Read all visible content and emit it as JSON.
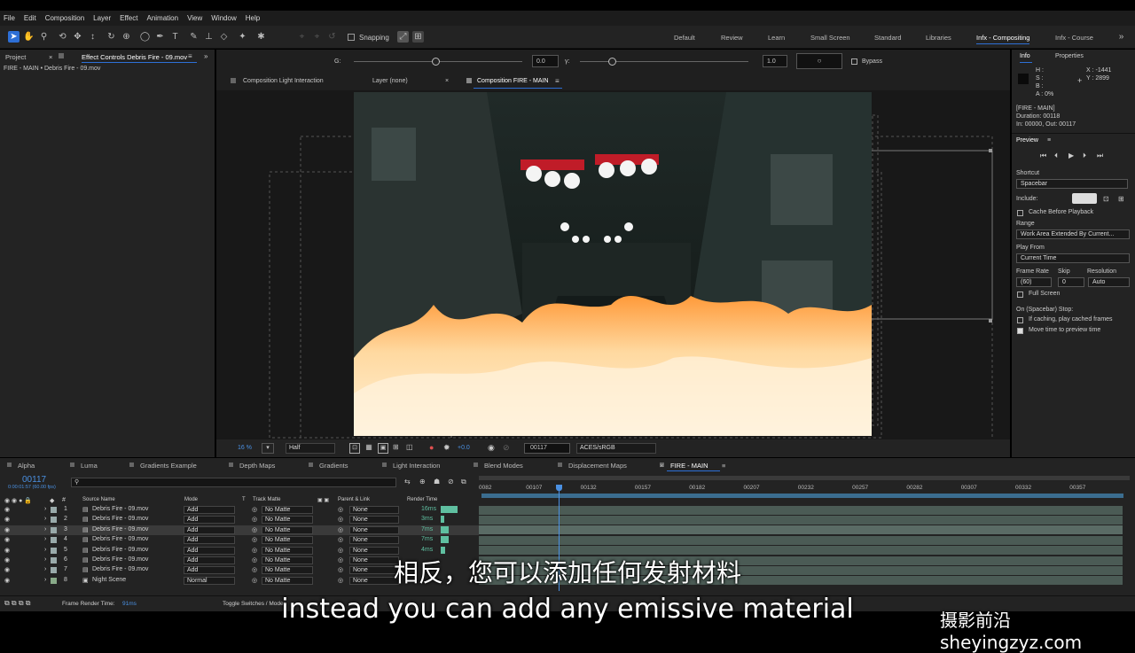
{
  "menu": [
    "File",
    "Edit",
    "Composition",
    "Layer",
    "Effect",
    "Animation",
    "View",
    "Window",
    "Help"
  ],
  "toolbar": {
    "snapping": "Snapping",
    "workspaces": [
      "Default",
      "Review",
      "Learn",
      "Small Screen",
      "Standard",
      "Libraries",
      "Infx - Compositing",
      "Infx - Course"
    ],
    "active_workspace": "Infx - Compositing"
  },
  "left_panel": {
    "tab_project": "Project",
    "tab_effect_controls": "Effect Controls Debris Fire - 09.mov",
    "path": "FIRE - MAIN • Debris Fire - 09.mov"
  },
  "comp": {
    "g_value": "0.0",
    "y_value": "1.0",
    "g_label": "G:",
    "y_label": "γ:",
    "o_label": "○",
    "bypass": "Bypass",
    "tabs": [
      "Composition Light Interaction",
      "Layer (none)",
      "Composition FIRE - MAIN"
    ],
    "zoom": "16 %",
    "resolution": "Half",
    "exposure": "+0.0",
    "timecode": "00117",
    "color_space": "ACES/sRGB"
  },
  "info": {
    "tab_info": "Info",
    "tab_properties": "Properties",
    "h": "H :",
    "s": "S :",
    "b": "B :",
    "a": "A : 0%",
    "x": "X : -1441",
    "y": "Y : 2899",
    "comp_name": "[FIRE - MAIN]",
    "duration": "Duration: 00118",
    "in_out": "In: 00000, Out: 00117"
  },
  "preview": {
    "title": "Preview",
    "shortcut_label": "Shortcut",
    "shortcut": "Spacebar",
    "include_label": "Include:",
    "cache_before": "Cache Before Playback",
    "range_label": "Range",
    "range": "Work Area Extended By Current...",
    "play_from_label": "Play From",
    "play_from": "Current Time",
    "frame_rate_label": "Frame Rate",
    "skip_label": "Skip",
    "resolution_label": "Resolution",
    "frame_rate": "(60)",
    "skip": "0",
    "resolution": "Auto",
    "full_screen": "Full Screen",
    "on_stop": "On (Spacebar) Stop:",
    "if_caching": "If caching, play cached frames",
    "move_time": "Move time to preview time"
  },
  "timeline": {
    "tabs": [
      "Alpha",
      "Luma",
      "Gradients Example",
      "Depth Maps",
      "Gradients",
      "Light Interaction",
      "Blend Modes",
      "Displacement Maps",
      "FIRE - MAIN"
    ],
    "current_time": "00117",
    "current_time_sub": "0:00:01:57 (60.00 fps)",
    "search_placeholder": "",
    "headers": {
      "source": "Source Name",
      "mode": "Mode",
      "t": "T",
      "track_matte": "Track Matte",
      "parent": "Parent & Link",
      "render_time": "Render Time"
    },
    "layers": [
      {
        "num": "1",
        "name": "Debris Fire - 09.mov",
        "mode": "Add",
        "matte": "No Matte",
        "parent": "None",
        "rt": "16ms",
        "rt_frac": 1.0
      },
      {
        "num": "2",
        "name": "Debris Fire - 09.mov",
        "mode": "Add",
        "matte": "No Matte",
        "parent": "None",
        "rt": "3ms",
        "rt_frac": 0.2
      },
      {
        "num": "3",
        "name": "Debris Fire - 09.mov",
        "mode": "Add",
        "matte": "No Matte",
        "parent": "None",
        "rt": "7ms",
        "rt_frac": 0.45
      },
      {
        "num": "4",
        "name": "Debris Fire - 09.mov",
        "mode": "Add",
        "matte": "No Matte",
        "parent": "None",
        "rt": "7ms",
        "rt_frac": 0.45
      },
      {
        "num": "5",
        "name": "Debris Fire - 09.mov",
        "mode": "Add",
        "matte": "No Matte",
        "parent": "None",
        "rt": "4ms",
        "rt_frac": 0.25
      },
      {
        "num": "6",
        "name": "Debris Fire - 09.mov",
        "mode": "Add",
        "matte": "No Matte",
        "parent": "None",
        "rt": "",
        "rt_frac": 0
      },
      {
        "num": "7",
        "name": "Debris Fire - 09.mov",
        "mode": "Add",
        "matte": "No Matte",
        "parent": "None",
        "rt": "",
        "rt_frac": 0
      },
      {
        "num": "8",
        "name": "Night Scene",
        "mode": "Normal",
        "matte": "No Matte",
        "parent": "None",
        "rt": "",
        "rt_frac": 0
      }
    ],
    "ruler": [
      "0082",
      "00107",
      "00132",
      "00157",
      "00182",
      "00207",
      "00232",
      "00257",
      "00282",
      "00307",
      "00332",
      "00357"
    ],
    "frame_render_time_label": "Frame Render Time:",
    "frame_render_time": "91ms",
    "toggle": "Toggle Switches / Modes"
  },
  "subtitles": {
    "zh": "相反，您可以添加任何发射材料",
    "en": "instead you can add any emissive material"
  },
  "watermark": "摄影前沿 sheyingzyz.com",
  "colors": {
    "accent": "#2d6fd6",
    "render_bar": "#5fbfa0",
    "track": "#4b5b55"
  }
}
